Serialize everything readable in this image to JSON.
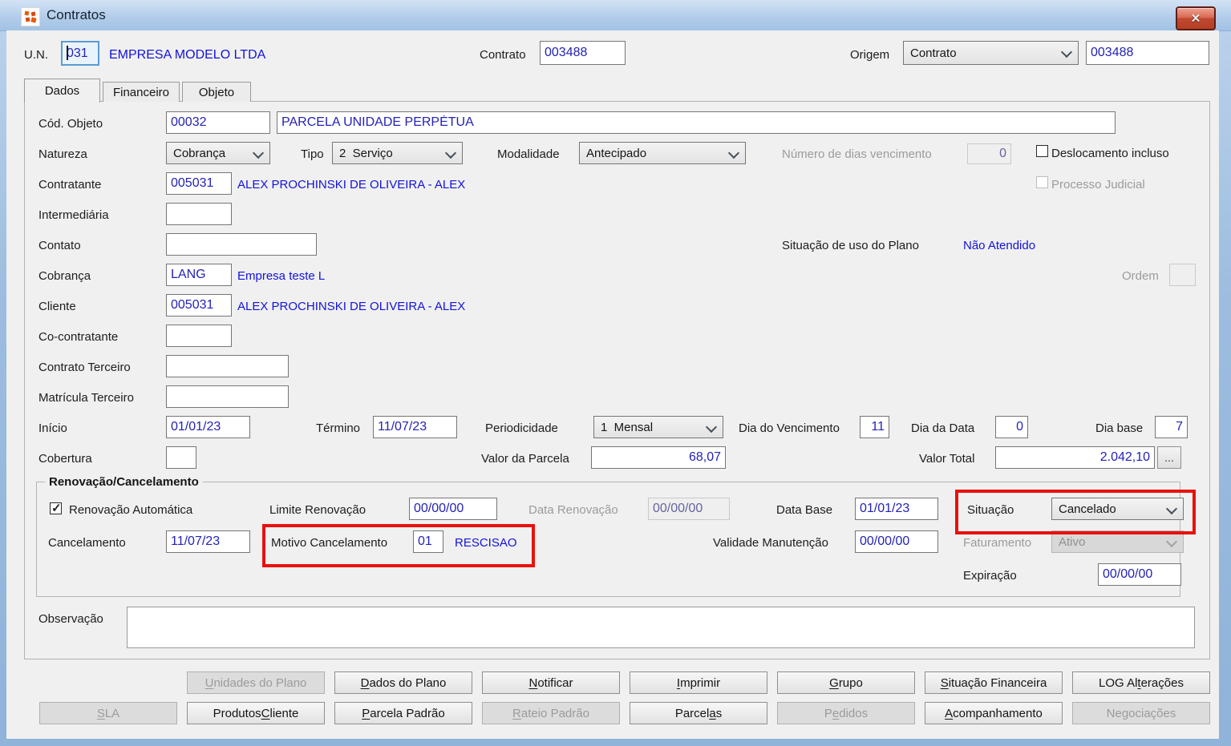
{
  "window": {
    "title": "Contratos",
    "close_icon": "✕"
  },
  "header": {
    "un_label": "U.N.",
    "un_value": "031",
    "un_company": "EMPRESA MODELO LTDA",
    "contrato_label": "Contrato",
    "contrato_value": "003488",
    "origem_label": "Origem",
    "origem_value": "Contrato",
    "origem_code": "003488"
  },
  "tabs": {
    "dados": "Dados",
    "financeiro": "Financeiro",
    "objeto": "Objeto"
  },
  "form": {
    "cod_objeto": {
      "label": "Cód. Objeto",
      "code": "00032",
      "desc": "PARCELA UNIDADE PERPÉTUA"
    },
    "natureza": {
      "label": "Natureza",
      "value": "Cobrança"
    },
    "tipo": {
      "label": "Tipo",
      "value": "2  Serviço"
    },
    "modalidade": {
      "label": "Modalidade",
      "value": "Antecipado"
    },
    "num_dias_vencimento": {
      "label": "Número de dias vencimento",
      "value": "0"
    },
    "deslocamento_incluso": {
      "label": "Deslocamento incluso",
      "checked": false
    },
    "processo_judicial": {
      "label": "Processo Judicial",
      "checked": false
    },
    "contratante": {
      "label": "Contratante",
      "code": "005031",
      "desc": "ALEX PROCHINSKI DE OLIVEIRA - ALEX"
    },
    "intermediaria": {
      "label": "Intermediária",
      "value": ""
    },
    "contato": {
      "label": "Contato",
      "value": ""
    },
    "situacao_uso_plano": {
      "label": "Situação de uso do Plano",
      "value": "Não Atendido"
    },
    "cobranca": {
      "label": "Cobrança",
      "code": "LANG",
      "desc": "Empresa teste L"
    },
    "ordem": {
      "label": "Ordem",
      "value": ""
    },
    "cliente": {
      "label": "Cliente",
      "code": "005031",
      "desc": "ALEX PROCHINSKI DE OLIVEIRA - ALEX"
    },
    "co_contratante": {
      "label": "Co-contratante",
      "value": ""
    },
    "contrato_terceiro": {
      "label": "Contrato Terceiro",
      "value": ""
    },
    "matricula_terceiro": {
      "label": "Matrícula Terceiro",
      "value": ""
    },
    "inicio": {
      "label": "Início",
      "value": "01/01/23"
    },
    "termino": {
      "label": "Término",
      "value": "11/07/23"
    },
    "periodicidade": {
      "label": "Periodicidade",
      "value": "1  Mensal"
    },
    "dia_vencimento": {
      "label": "Dia do Vencimento",
      "value": "11"
    },
    "dia_data": {
      "label": "Dia da Data",
      "value": "0"
    },
    "dia_base": {
      "label": "Dia base",
      "value": "7"
    },
    "cobertura": {
      "label": "Cobertura",
      "value": ""
    },
    "valor_parcela": {
      "label": "Valor da Parcela",
      "value": "68,07"
    },
    "valor_total": {
      "label": "Valor Total",
      "value": "2.042,10",
      "more_label": "..."
    }
  },
  "renovacao": {
    "title": "Renovação/Cancelamento",
    "renovacao_automatica": {
      "label": "Renovação Automática",
      "checked": true
    },
    "limite_renovacao": {
      "label": "Limite Renovação",
      "value": "00/00/00"
    },
    "data_renovacao": {
      "label": "Data Renovação",
      "value": "00/00/00"
    },
    "data_base": {
      "label": "Data Base",
      "value": "01/01/23"
    },
    "situacao": {
      "label": "Situação",
      "value": "Cancelado"
    },
    "cancelamento": {
      "label": "Cancelamento",
      "value": "11/07/23"
    },
    "motivo_cancelamento": {
      "label": "Motivo Cancelamento",
      "code": "01",
      "desc": "RESCISAO"
    },
    "validade_manutencao": {
      "label": "Validade Manutenção",
      "value": "00/00/00"
    },
    "faturamento": {
      "label": "Faturamento",
      "value": "Ativo"
    },
    "expiracao": {
      "label": "Expiração",
      "value": "00/00/00"
    }
  },
  "observacao": {
    "label": "Observação",
    "value": ""
  },
  "buttons": {
    "row1": [
      {
        "label": "Unidades do Plano",
        "accel": 0,
        "enabled": false
      },
      {
        "label": "Dados do Plano",
        "accel": 0,
        "enabled": true
      },
      {
        "label": "Notificar",
        "accel": 0,
        "enabled": true
      },
      {
        "label": "Imprimir",
        "accel": 0,
        "enabled": true
      },
      {
        "label": "Grupo",
        "accel": 0,
        "enabled": true
      },
      {
        "label": "Situação Financeira",
        "accel": 0,
        "enabled": true
      },
      {
        "label": "LOG Alterações",
        "accel": 6,
        "enabled": true
      }
    ],
    "row2": [
      {
        "label": "SLA",
        "accel": 0,
        "enabled": false
      },
      {
        "label": "Produtos Cliente",
        "accel": 9,
        "enabled": true
      },
      {
        "label": "Parcela Padrão",
        "accel": 0,
        "enabled": true
      },
      {
        "label": "Rateio Padrão",
        "accel": 0,
        "enabled": false
      },
      {
        "label": "Parcelas",
        "accel": 6,
        "enabled": true
      },
      {
        "label": "Pedidos",
        "accel": 1,
        "enabled": false
      },
      {
        "label": "Acompanhamento",
        "accel": 0,
        "enabled": true
      },
      {
        "label": "Negociações",
        "accel": -1,
        "enabled": false
      }
    ]
  },
  "colors": {
    "highlight_red": "#e8110f",
    "titlebar_blue": "#a9c7e8",
    "value_navy": "#2422b6",
    "link_blue": "#1412dc",
    "close_red": "#c04a30"
  }
}
